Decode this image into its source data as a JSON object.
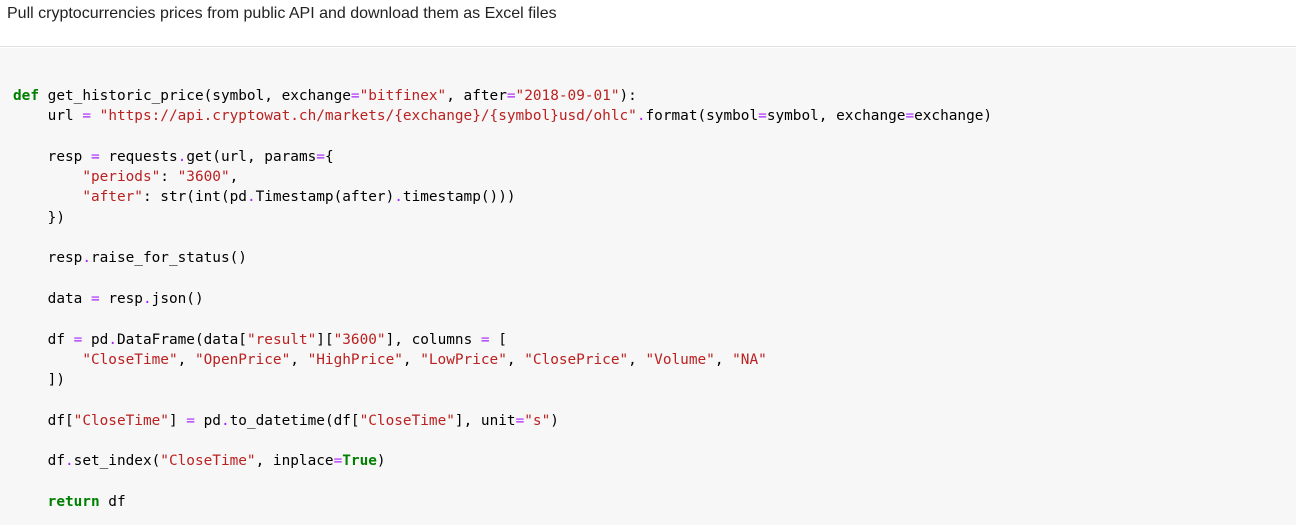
{
  "markdown": {
    "text": "Pull cryptocurrencies prices from public API and download them as Excel files"
  },
  "code": {
    "lines": [
      [
        {
          "t": "def",
          "c": "kw"
        },
        {
          "t": " get_historic_price(symbol, exchange",
          "c": ""
        },
        {
          "t": "=",
          "c": "op"
        },
        {
          "t": "\"bitfinex\"",
          "c": "str"
        },
        {
          "t": ", after",
          "c": ""
        },
        {
          "t": "=",
          "c": "op"
        },
        {
          "t": "\"2018-09-01\"",
          "c": "str"
        },
        {
          "t": "):",
          "c": ""
        }
      ],
      [
        {
          "t": "    url ",
          "c": ""
        },
        {
          "t": "=",
          "c": "op"
        },
        {
          "t": " ",
          "c": ""
        },
        {
          "t": "\"https://api.cryptowat.ch/markets/{exchange}/{symbol}usd/ohlc\"",
          "c": "str"
        },
        {
          "t": ".",
          "c": "op"
        },
        {
          "t": "format(symbol",
          "c": ""
        },
        {
          "t": "=",
          "c": "op"
        },
        {
          "t": "symbol, exchange",
          "c": ""
        },
        {
          "t": "=",
          "c": "op"
        },
        {
          "t": "exchange)",
          "c": ""
        }
      ],
      [],
      [
        {
          "t": "    resp ",
          "c": ""
        },
        {
          "t": "=",
          "c": "op"
        },
        {
          "t": " requests",
          "c": ""
        },
        {
          "t": ".",
          "c": "op"
        },
        {
          "t": "get(url, params",
          "c": ""
        },
        {
          "t": "=",
          "c": "op"
        },
        {
          "t": "{",
          "c": ""
        }
      ],
      [
        {
          "t": "        ",
          "c": ""
        },
        {
          "t": "\"periods\"",
          "c": "str"
        },
        {
          "t": ": ",
          "c": ""
        },
        {
          "t": "\"3600\"",
          "c": "str"
        },
        {
          "t": ",",
          "c": ""
        }
      ],
      [
        {
          "t": "        ",
          "c": ""
        },
        {
          "t": "\"after\"",
          "c": "str"
        },
        {
          "t": ": str(int(pd",
          "c": ""
        },
        {
          "t": ".",
          "c": "op"
        },
        {
          "t": "Timestamp(after)",
          "c": ""
        },
        {
          "t": ".",
          "c": "op"
        },
        {
          "t": "timestamp()))",
          "c": ""
        }
      ],
      [
        {
          "t": "    })",
          "c": ""
        }
      ],
      [],
      [
        {
          "t": "    resp",
          "c": ""
        },
        {
          "t": ".",
          "c": "op"
        },
        {
          "t": "raise_for_status()",
          "c": ""
        }
      ],
      [],
      [
        {
          "t": "    data ",
          "c": ""
        },
        {
          "t": "=",
          "c": "op"
        },
        {
          "t": " resp",
          "c": ""
        },
        {
          "t": ".",
          "c": "op"
        },
        {
          "t": "json()",
          "c": ""
        }
      ],
      [],
      [
        {
          "t": "    df ",
          "c": ""
        },
        {
          "t": "=",
          "c": "op"
        },
        {
          "t": " pd",
          "c": ""
        },
        {
          "t": ".",
          "c": "op"
        },
        {
          "t": "DataFrame(data[",
          "c": ""
        },
        {
          "t": "\"result\"",
          "c": "str"
        },
        {
          "t": "][",
          "c": ""
        },
        {
          "t": "\"3600\"",
          "c": "str"
        },
        {
          "t": "], columns ",
          "c": ""
        },
        {
          "t": "=",
          "c": "op"
        },
        {
          "t": " [",
          "c": ""
        }
      ],
      [
        {
          "t": "        ",
          "c": ""
        },
        {
          "t": "\"CloseTime\"",
          "c": "str"
        },
        {
          "t": ", ",
          "c": ""
        },
        {
          "t": "\"OpenPrice\"",
          "c": "str"
        },
        {
          "t": ", ",
          "c": ""
        },
        {
          "t": "\"HighPrice\"",
          "c": "str"
        },
        {
          "t": ", ",
          "c": ""
        },
        {
          "t": "\"LowPrice\"",
          "c": "str"
        },
        {
          "t": ", ",
          "c": ""
        },
        {
          "t": "\"ClosePrice\"",
          "c": "str"
        },
        {
          "t": ", ",
          "c": ""
        },
        {
          "t": "\"Volume\"",
          "c": "str"
        },
        {
          "t": ", ",
          "c": ""
        },
        {
          "t": "\"NA\"",
          "c": "str"
        }
      ],
      [
        {
          "t": "    ])",
          "c": ""
        }
      ],
      [],
      [
        {
          "t": "    df[",
          "c": ""
        },
        {
          "t": "\"CloseTime\"",
          "c": "str"
        },
        {
          "t": "] ",
          "c": ""
        },
        {
          "t": "=",
          "c": "op"
        },
        {
          "t": " pd",
          "c": ""
        },
        {
          "t": ".",
          "c": "op"
        },
        {
          "t": "to_datetime(df[",
          "c": ""
        },
        {
          "t": "\"CloseTime\"",
          "c": "str"
        },
        {
          "t": "], unit",
          "c": ""
        },
        {
          "t": "=",
          "c": "op"
        },
        {
          "t": "\"s\"",
          "c": "str"
        },
        {
          "t": ")",
          "c": ""
        }
      ],
      [],
      [
        {
          "t": "    df",
          "c": ""
        },
        {
          "t": ".",
          "c": "op"
        },
        {
          "t": "set_index(",
          "c": ""
        },
        {
          "t": "\"CloseTime\"",
          "c": "str"
        },
        {
          "t": ", inplace",
          "c": ""
        },
        {
          "t": "=",
          "c": "op"
        },
        {
          "t": "True",
          "c": "kw"
        },
        {
          "t": ")",
          "c": ""
        }
      ],
      [],
      [
        {
          "t": "    ",
          "c": ""
        },
        {
          "t": "return",
          "c": "kw"
        },
        {
          "t": " df",
          "c": ""
        }
      ]
    ]
  },
  "colors": {
    "keyword": "#008000",
    "string": "#ba2121",
    "operator": "#aa22ff",
    "code_background": "#f7f7f7"
  }
}
